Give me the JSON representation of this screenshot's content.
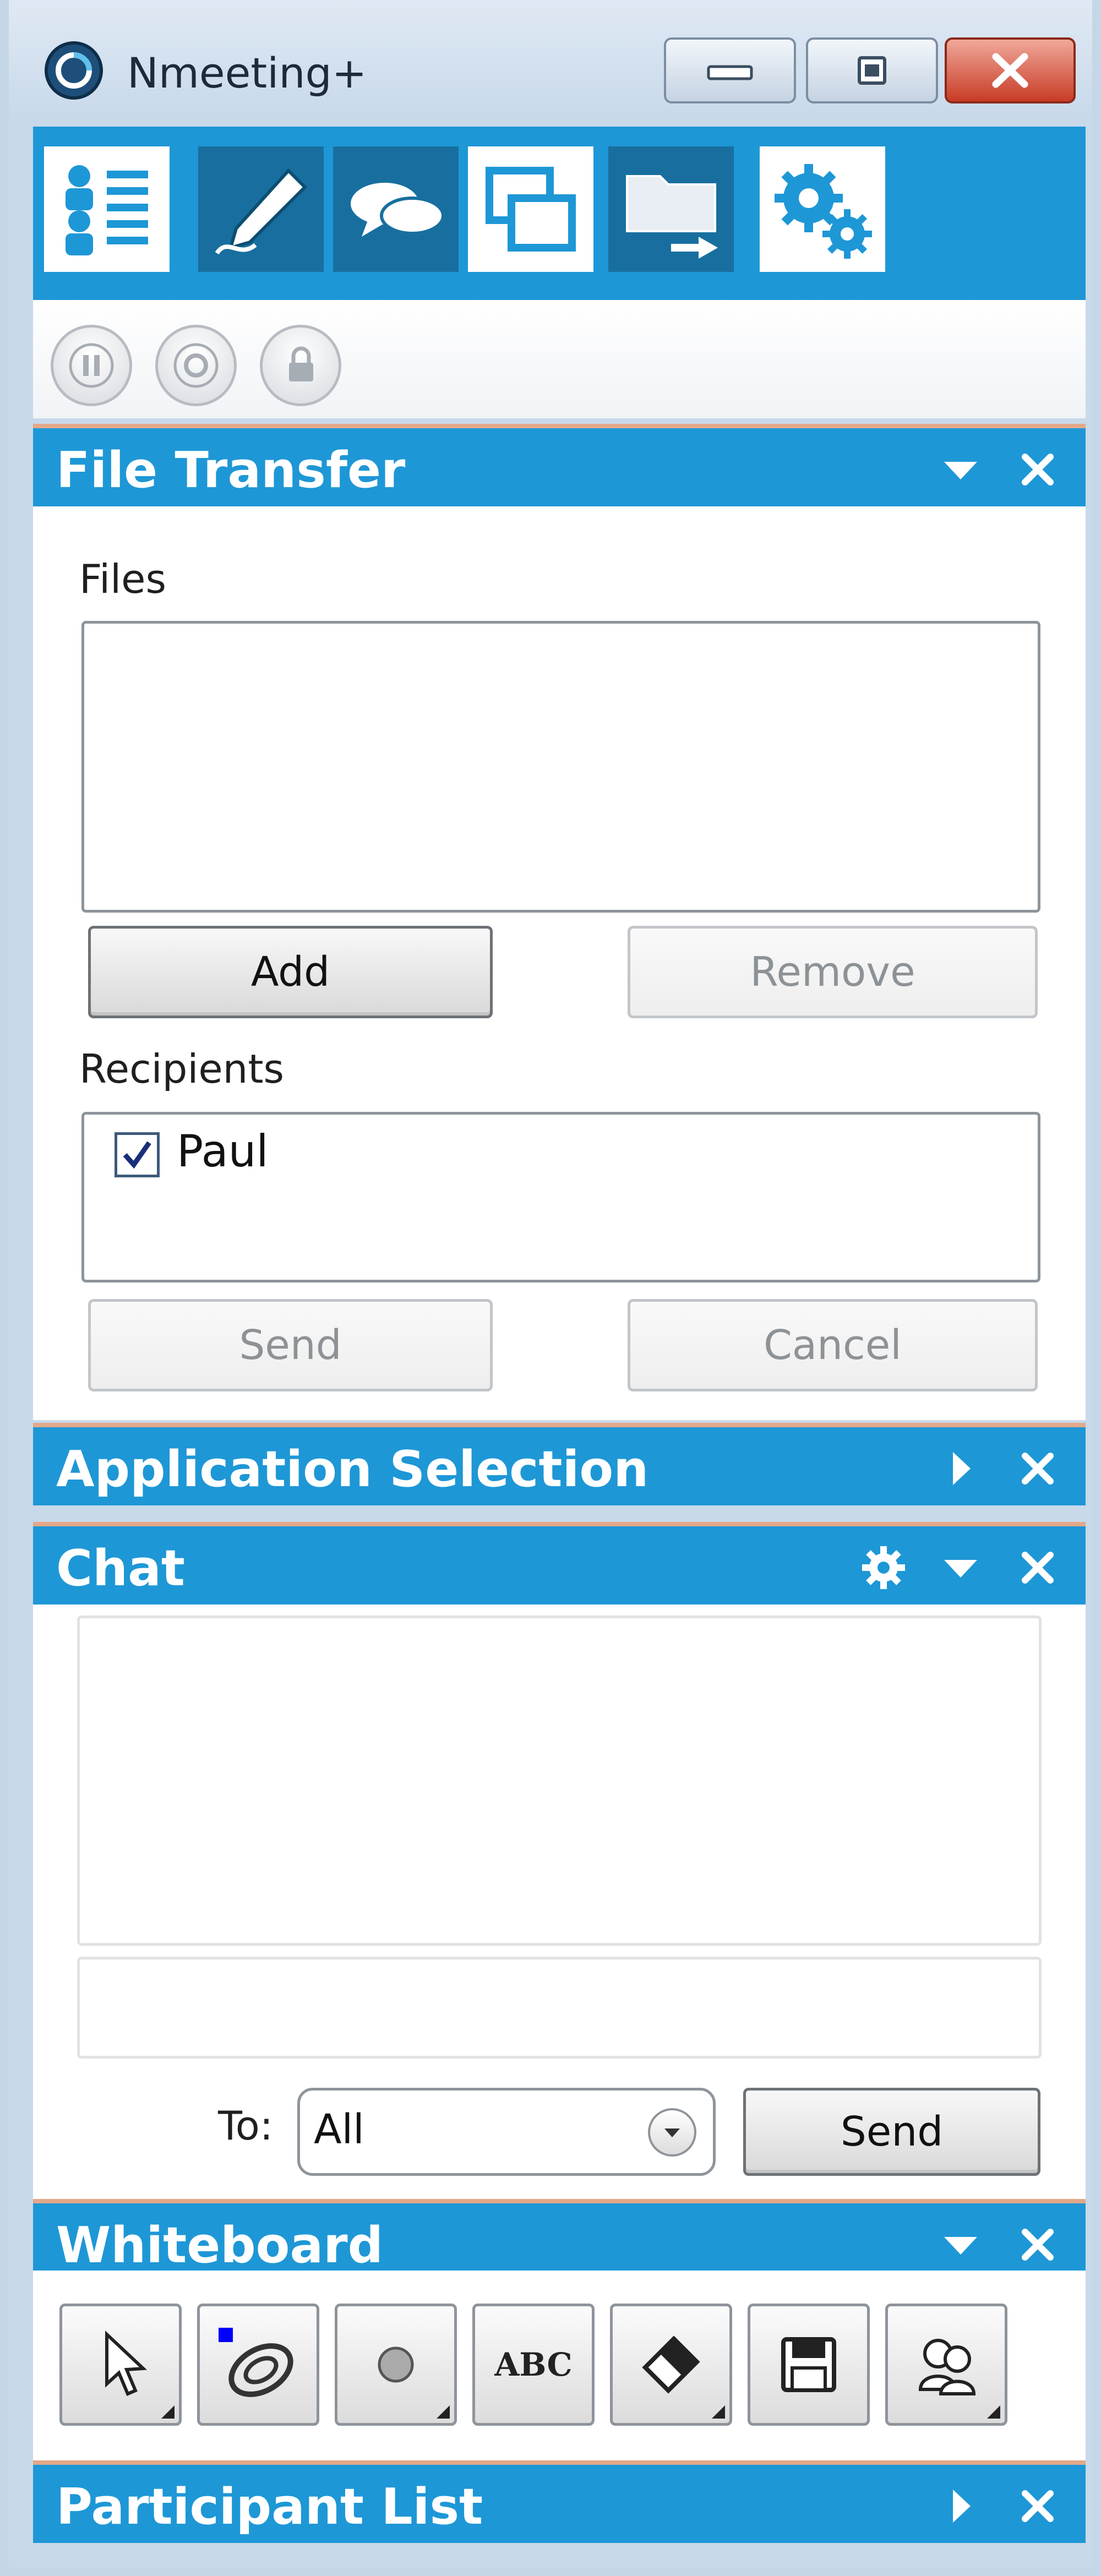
{
  "window": {
    "title": "Nmeeting+",
    "logo_icon": "nmeeting-logo-icon",
    "controls": [
      "minimize-icon",
      "maximize-icon",
      "close-icon"
    ]
  },
  "toolbar": {
    "items": [
      {
        "name": "participants",
        "icon": "participant-list-icon"
      },
      {
        "name": "whiteboard",
        "icon": "pencil-icon"
      },
      {
        "name": "chat",
        "icon": "chat-bubbles-icon"
      },
      {
        "name": "application-sharing",
        "icon": "windows-icon"
      },
      {
        "name": "file-transfer",
        "icon": "folder-transfer-icon"
      },
      {
        "name": "settings",
        "icon": "gears-icon"
      }
    ],
    "accent": "#1e97d6"
  },
  "controls": {
    "items": [
      "pause-icon",
      "stop-icon",
      "lock-icon"
    ]
  },
  "file_transfer": {
    "title": "File Transfer",
    "files_label": "Files",
    "files": [],
    "add_label": "Add",
    "remove_label": "Remove",
    "recipients_label": "Recipients",
    "recipients": [
      {
        "name": "Paul",
        "checked": true
      }
    ],
    "send_label": "Send",
    "cancel_label": "Cancel"
  },
  "application_selection": {
    "title": "Application Selection"
  },
  "chat": {
    "title": "Chat",
    "messages": [],
    "input_value": "",
    "to_label": "To:",
    "to_value": "All",
    "send_label": "Send"
  },
  "whiteboard": {
    "title": "Whiteboard",
    "tools": [
      "pointer-icon",
      "pen-icon",
      "circle-icon",
      "text-icon",
      "eraser-icon",
      "save-icon",
      "sync-icon"
    ],
    "text_tool_label": "ABC",
    "pen_color": "#0000ff"
  },
  "participant_list": {
    "title": "Participant List"
  }
}
